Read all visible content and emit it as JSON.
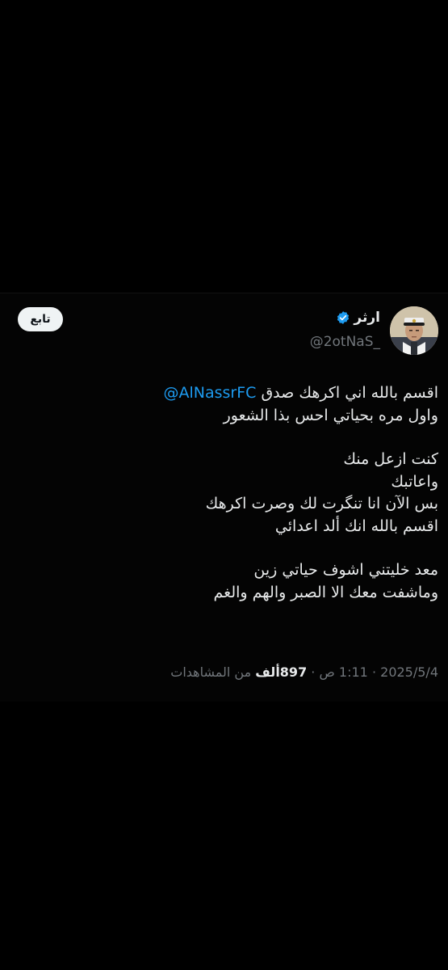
{
  "tweet": {
    "author": {
      "display_name": "ارثر",
      "handle": "@2otNaS_",
      "verified": true,
      "avatar_icon": "profile-photo-icon"
    },
    "follow_label": "تابع",
    "mention": "@AlNassrFC",
    "lines": {
      "l1_text": "اقسم بالله اني اكرهك صدق",
      "l2": "واول مره بحياتي احس بذا الشعور",
      "l3": "كنت ازعل منك",
      "l4": "واعاتبك",
      "l5": "بس الآن انا تنگرت لك وصرت اكرهك",
      "l6": "اقسم بالله انك ألد اعدائي",
      "l7": "معد خليتني اشوف حياتي زين",
      "l8": "وماشفت معك الا الصبر والهم والغم"
    },
    "meta": {
      "date": "2025/5/4",
      "time": "1:11 ص",
      "views_count": "897",
      "views_unit": "ألف",
      "views_label": "من المشاهدات",
      "separator": "·"
    }
  },
  "colors": {
    "background": "#000000",
    "text": "#e7e9ea",
    "muted": "#71767b",
    "link": "#1d9bf0",
    "verified": "#1d9bf0",
    "button_bg": "#eff3f4"
  }
}
